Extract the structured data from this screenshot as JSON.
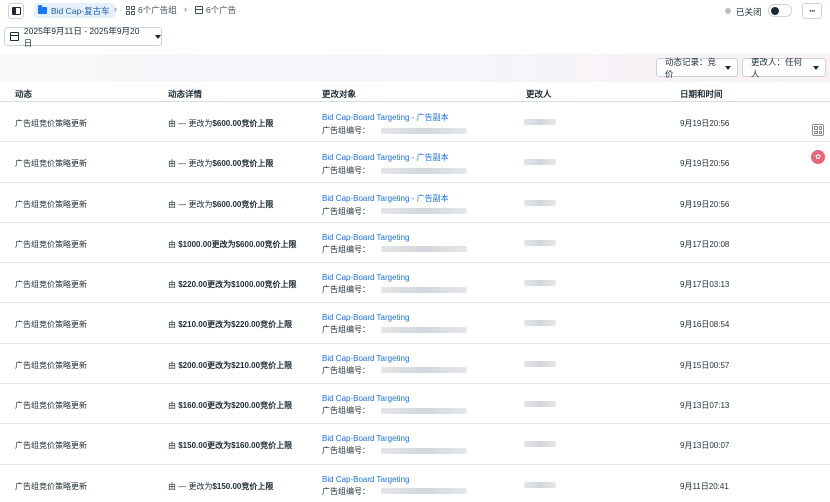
{
  "breadcrumb": {
    "campaign": "Bid Cap-复古车",
    "adset_group": "6个广告组",
    "ads": "6个广告"
  },
  "status": {
    "label": "已关闭",
    "color": "#bcc0c4"
  },
  "more_label": "···",
  "date_range": "2025年9月11日 - 2025年9月20日",
  "filters": {
    "activity": "动态记录：竞价",
    "editor": "更改人：任何人"
  },
  "columns": {
    "activity": "动态",
    "detail": "动态详情",
    "object": "更改对象",
    "editor": "更改人",
    "date": "日期和时间"
  },
  "rows": [
    {
      "activity": "广告组竞价策略更新",
      "detail_prefix": "由 — 更改为",
      "detail_bold": "$600.00竞价上限",
      "object": "Bid Cap-Board Targeting - 广告副本",
      "object_sub": "广告组编号：",
      "date": "9月19日20:56"
    },
    {
      "activity": "广告组竞价策略更新",
      "detail_prefix": "由 — 更改为",
      "detail_bold": "$600.00竞价上限",
      "object": "Bid Cap-Board Targeting - 广告副本",
      "object_sub": "广告组编号：",
      "date": "9月19日20:56"
    },
    {
      "activity": "广告组竞价策略更新",
      "detail_prefix": "由 — 更改为",
      "detail_bold": "$600.00竞价上限",
      "object": "Bid Cap-Board Targeting - 广告副本",
      "object_sub": "广告组编号：",
      "date": "9月19日20:56"
    },
    {
      "activity": "广告组竞价策略更新",
      "detail_prefix": "由 ",
      "detail_bold": "$1000.00更改为$600.00竞价上限",
      "object": "Bid Cap-Board Targeting",
      "object_sub": "广告组编号：",
      "date": "9月17日20:08"
    },
    {
      "activity": "广告组竞价策略更新",
      "detail_prefix": "由 ",
      "detail_bold": "$220.00更改为$1000.00竞价上限",
      "object": "Bid Cap-Board Targeting",
      "object_sub": "广告组编号：",
      "date": "9月17日03:13"
    },
    {
      "activity": "广告组竞价策略更新",
      "detail_prefix": "由 ",
      "detail_bold": "$210.00更改为$220.00竞价上限",
      "object": "Bid Cap-Board Targeting",
      "object_sub": "广告组编号：",
      "date": "9月16日08:54"
    },
    {
      "activity": "广告组竞价策略更新",
      "detail_prefix": "由 ",
      "detail_bold": "$200.00更改为$210.00竞价上限",
      "object": "Bid Cap-Board Targeting",
      "object_sub": "广告组编号：",
      "date": "9月15日00:57"
    },
    {
      "activity": "广告组竞价策略更新",
      "detail_prefix": "由 ",
      "detail_bold": "$160.00更改为$200.00竞价上限",
      "object": "Bid Cap-Board Targeting",
      "object_sub": "广告组编号：",
      "date": "9月13日07:13"
    },
    {
      "activity": "广告组竞价策略更新",
      "detail_prefix": "由 ",
      "detail_bold": "$150.00更改为$160.00竞价上限",
      "object": "Bid Cap-Board Targeting",
      "object_sub": "广告组编号：",
      "date": "9月13日00:07"
    },
    {
      "activity": "广告组竞价策略更新",
      "detail_prefix": "由 — 更改为",
      "detail_bold": "$150.00竞价上限",
      "object": "Bid Cap-Board Targeting",
      "object_sub": "广告组编号：",
      "date": "9月11日20:41"
    }
  ],
  "icons": {
    "panel": "sidebar-toggle-icon",
    "folder": "folder-icon",
    "adset": "grid-icon",
    "ad": "ad-square-icon",
    "calendar": "calendar-icon"
  },
  "colors": {
    "accent": "#1877f2",
    "link": "#1a73e8",
    "side_badge": "#e8657c"
  }
}
